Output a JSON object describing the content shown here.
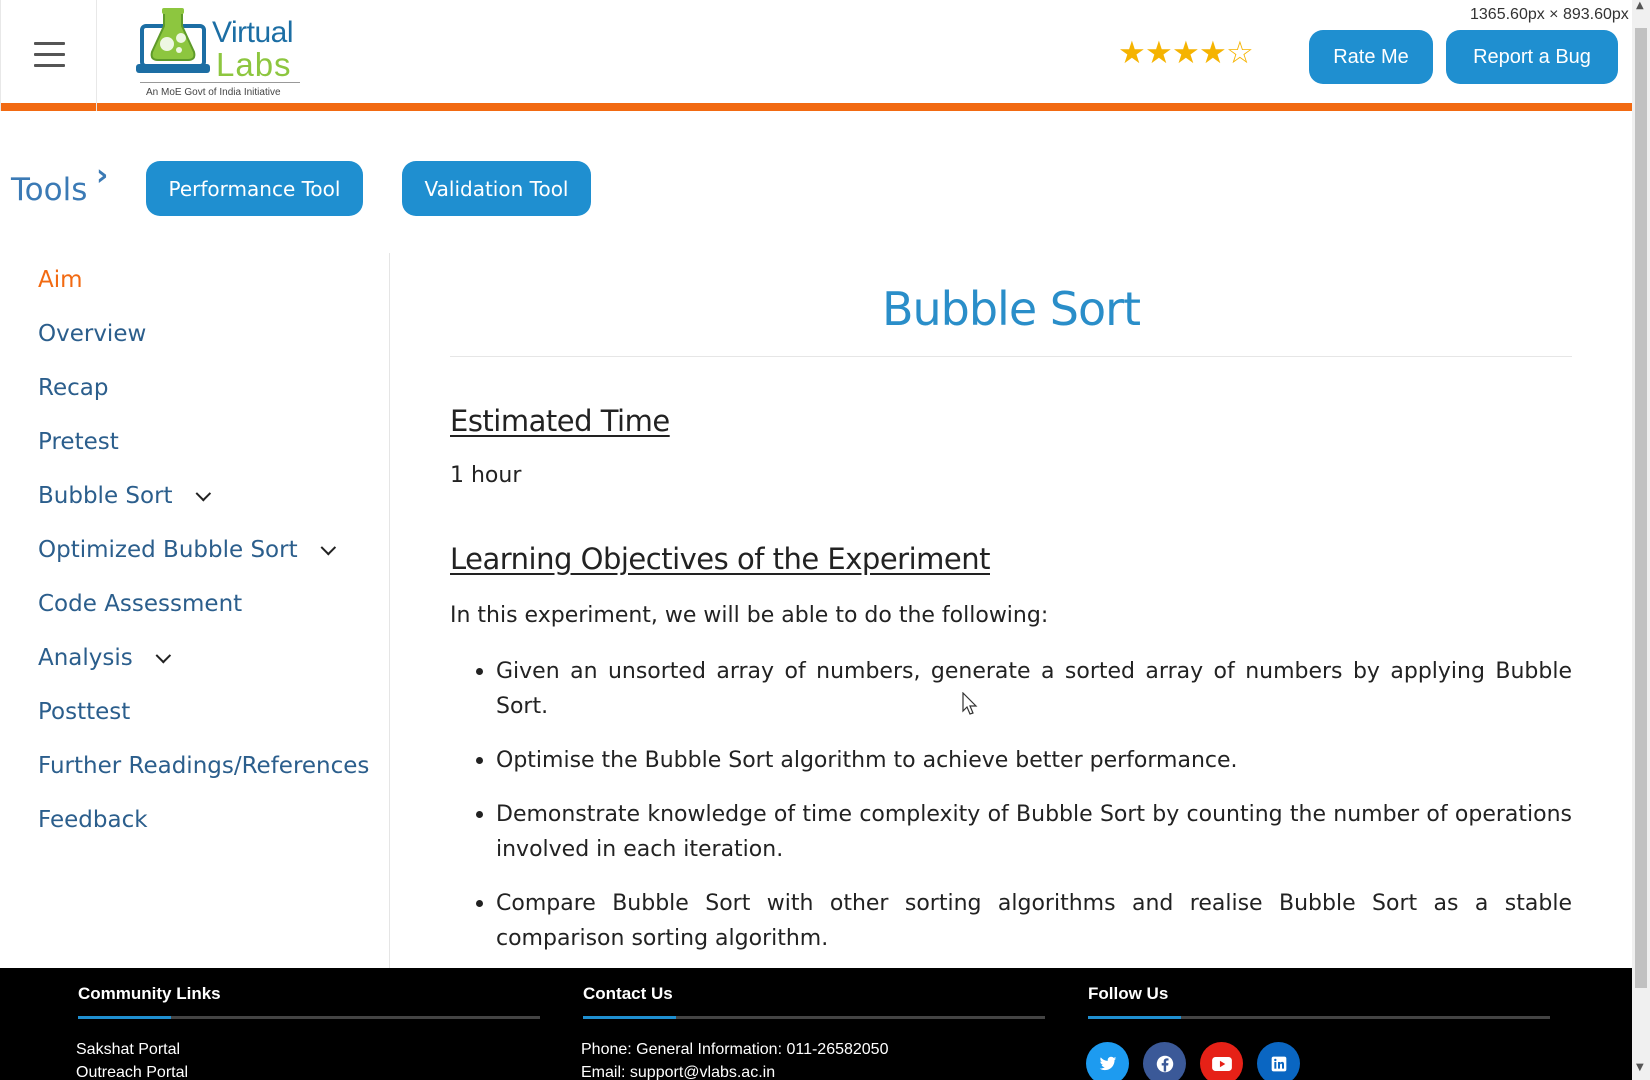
{
  "header": {
    "logo": {
      "word1": "Virtual",
      "word2": "Labs",
      "tagline": "An MoE Govt of India Initiative"
    },
    "rating": {
      "value": 4,
      "max": 5
    },
    "rate_label": "Rate Me",
    "bug_label": "Report a Bug",
    "dims_readout": "1365.60px × 893.60px"
  },
  "toolbar": {
    "label": "Tools",
    "performance": "Performance Tool",
    "validation": "Validation Tool"
  },
  "sidebar": {
    "items": [
      {
        "label": "Aim",
        "active": true,
        "expandable": false
      },
      {
        "label": "Overview",
        "active": false,
        "expandable": false
      },
      {
        "label": "Recap",
        "active": false,
        "expandable": false
      },
      {
        "label": "Pretest",
        "active": false,
        "expandable": false
      },
      {
        "label": "Bubble Sort",
        "active": false,
        "expandable": true
      },
      {
        "label": "Optimized Bubble Sort",
        "active": false,
        "expandable": true
      },
      {
        "label": "Code Assessment",
        "active": false,
        "expandable": false
      },
      {
        "label": "Analysis",
        "active": false,
        "expandable": true
      },
      {
        "label": "Posttest",
        "active": false,
        "expandable": false
      },
      {
        "label": "Further Readings/References",
        "active": false,
        "expandable": false
      },
      {
        "label": "Feedback",
        "active": false,
        "expandable": false
      }
    ]
  },
  "main": {
    "title": "Bubble Sort",
    "estimated_time_heading": "Estimated Time",
    "estimated_time_value": "1 hour",
    "objectives_heading": "Learning Objectives of the Experiment",
    "objectives_intro": "In this experiment, we will be able to do the following:",
    "objectives": [
      "Given an unsorted array of numbers, generate a sorted array of numbers by applying Bubble Sort.",
      "Optimise the Bubble Sort algorithm to achieve better performance.",
      "Demonstrate knowledge of time complexity of Bubble Sort by counting the number of operations involved in each iteration.",
      "Compare Bubble Sort with other sorting algorithms and realise Bubble Sort as a stable comparison sorting algorithm."
    ]
  },
  "footer": {
    "community_title": "Community Links",
    "community_links": [
      "Sakshat Portal",
      "Outreach Portal"
    ],
    "contact_title": "Contact Us",
    "contact_phone": "Phone: General Information: 011-26582050",
    "contact_email": "Email: support@vlabs.ac.in",
    "follow_title": "Follow Us",
    "social": [
      {
        "name": "twitter",
        "color": "#1d9bf0"
      },
      {
        "name": "facebook",
        "color": "#3b5998"
      },
      {
        "name": "youtube",
        "color": "#e62117"
      },
      {
        "name": "linkedin",
        "color": "#0a66c2"
      }
    ]
  }
}
